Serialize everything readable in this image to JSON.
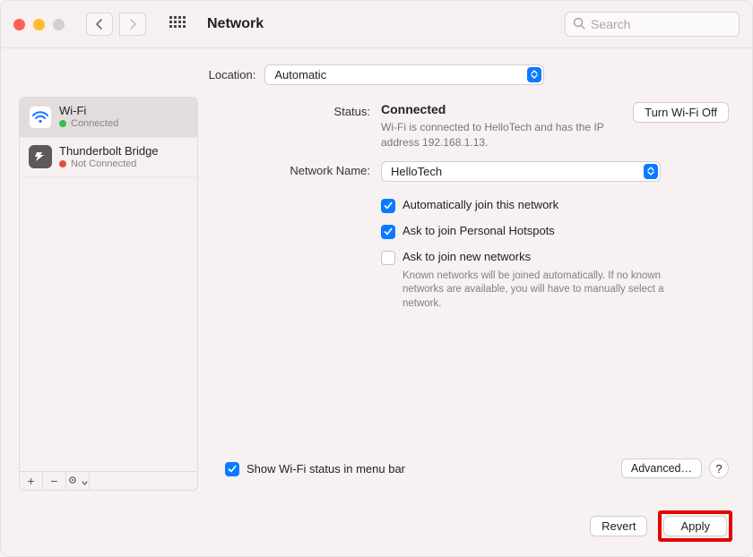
{
  "titlebar": {
    "title": "Network",
    "search_placeholder": "Search"
  },
  "location": {
    "label": "Location:",
    "value": "Automatic"
  },
  "sidebar": {
    "services": [
      {
        "name": "Wi-Fi",
        "status": "Connected",
        "status_kind": "green",
        "icon": "wifi"
      },
      {
        "name": "Thunderbolt Bridge",
        "status": "Not Connected",
        "status_kind": "red",
        "icon": "thunderbolt-bridge"
      }
    ],
    "tools": {
      "add": "+",
      "remove": "−",
      "options": "☺︎"
    }
  },
  "details": {
    "status_label": "Status:",
    "status_value": "Connected",
    "status_substatus": "Wi-Fi is connected to HelloTech and has the IP address 192.168.1.13.",
    "turn_off_label": "Turn Wi-Fi Off",
    "network_name_label": "Network Name:",
    "network_name_value": "HelloTech",
    "auto_join_label": "Automatically join this network",
    "ask_personal_hotspots_label": "Ask to join Personal Hotspots",
    "ask_new_networks_label": "Ask to join new networks",
    "ask_new_networks_hint": "Known networks will be joined automatically. If no known networks are available, you will have to manually select a network.",
    "show_menu_bar_label": "Show Wi-Fi status in menu bar",
    "advanced_label": "Advanced…",
    "help_label": "?"
  },
  "footer": {
    "revert_label": "Revert",
    "apply_label": "Apply"
  }
}
